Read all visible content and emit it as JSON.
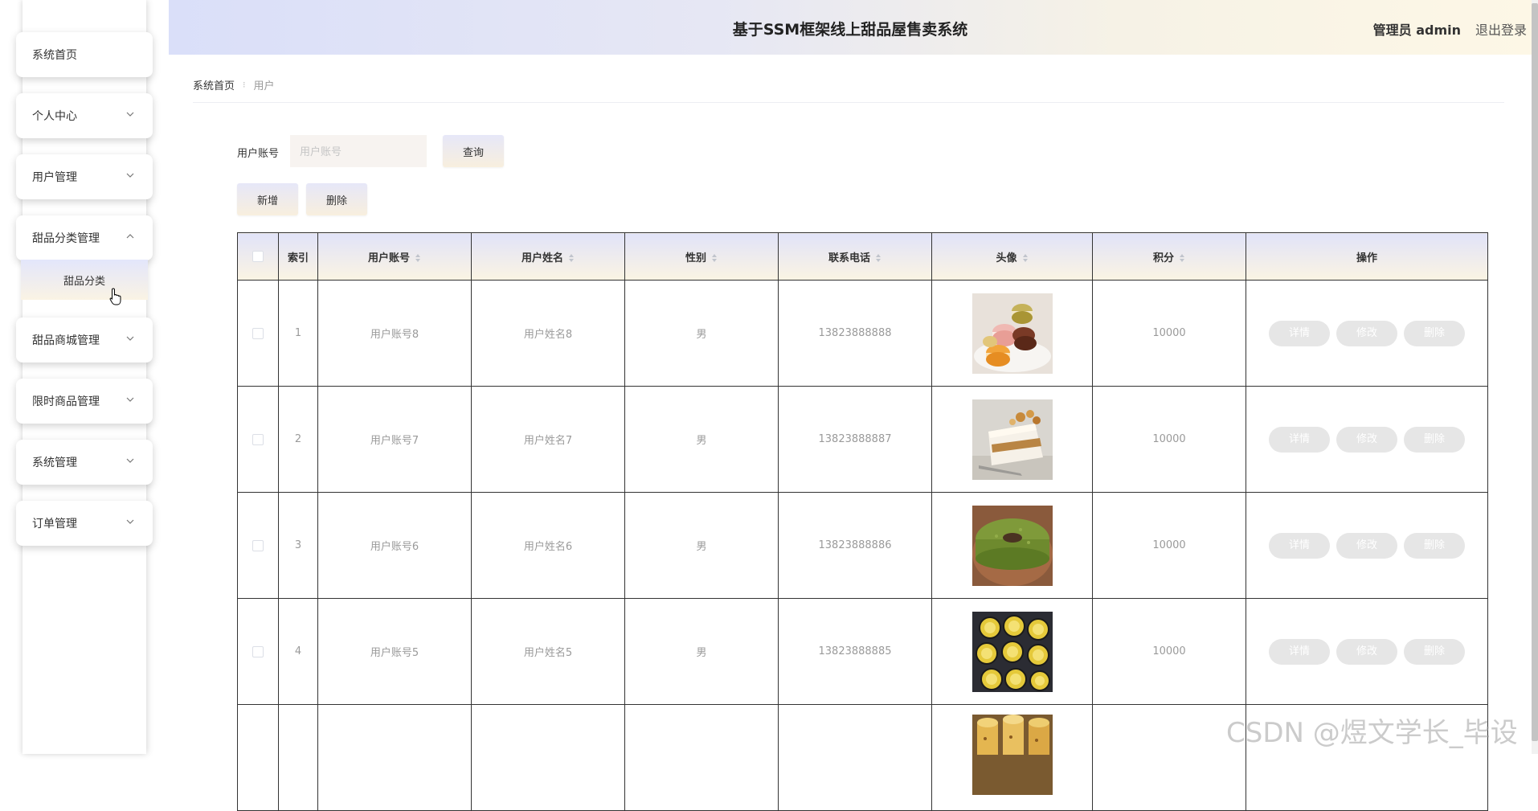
{
  "header": {
    "title": "基于SSM框架线上甜品屋售卖系统",
    "admin_label": "管理员 admin",
    "logout_label": "退出登录"
  },
  "sidebar": {
    "items": [
      {
        "label": "系统首页",
        "has_arrow": false
      },
      {
        "label": "个人中心",
        "has_arrow": true
      },
      {
        "label": "用户管理",
        "has_arrow": true
      },
      {
        "label": "甜品分类管理",
        "has_arrow": true,
        "expanded": true
      },
      {
        "label": "甜品商城管理",
        "has_arrow": true
      },
      {
        "label": "限时商品管理",
        "has_arrow": true
      },
      {
        "label": "系统管理",
        "has_arrow": true
      },
      {
        "label": "订单管理",
        "has_arrow": true
      }
    ],
    "submenu_label": "甜品分类"
  },
  "breadcrumb": {
    "home": "系统首页",
    "separator": "⁝",
    "current": "用户"
  },
  "search": {
    "label": "用户账号",
    "placeholder": "用户账号",
    "query_label": "查询"
  },
  "actions": {
    "add_label": "新增",
    "delete_label": "删除"
  },
  "table": {
    "headers": [
      "索引",
      "用户账号",
      "用户姓名",
      "性别",
      "联系电话",
      "头像",
      "积分",
      "操作"
    ],
    "rows": [
      {
        "index": "1",
        "account": "用户账号8",
        "name": "用户姓名8",
        "gender": "男",
        "phone": "13823888888",
        "avatar": "macarons-photo",
        "points": "10000"
      },
      {
        "index": "2",
        "account": "用户账号7",
        "name": "用户姓名7",
        "gender": "男",
        "phone": "13823888887",
        "avatar": "cake-slice-photo",
        "points": "10000"
      },
      {
        "index": "3",
        "account": "用户账号6",
        "name": "用户姓名6",
        "gender": "男",
        "phone": "13823888886",
        "avatar": "matcha-bundt-photo",
        "points": "10000"
      },
      {
        "index": "4",
        "account": "用户账号5",
        "name": "用户姓名5",
        "gender": "男",
        "phone": "13823888885",
        "avatar": "egg-tarts-photo",
        "points": "10000"
      },
      {
        "index": "",
        "account": "",
        "name": "",
        "gender": "",
        "phone": "",
        "avatar": "cupcakes-photo",
        "points": ""
      }
    ],
    "row_actions": {
      "detail": "详情",
      "edit": "修改",
      "delete": "删除"
    }
  },
  "watermark": "CSDN @煜文学长_毕设",
  "colors": {
    "header_gradient_start": "#dadff9",
    "header_gradient_end": "#fdf7e6",
    "button_disabled": "#e6e6e6",
    "table_border": "#333333"
  }
}
